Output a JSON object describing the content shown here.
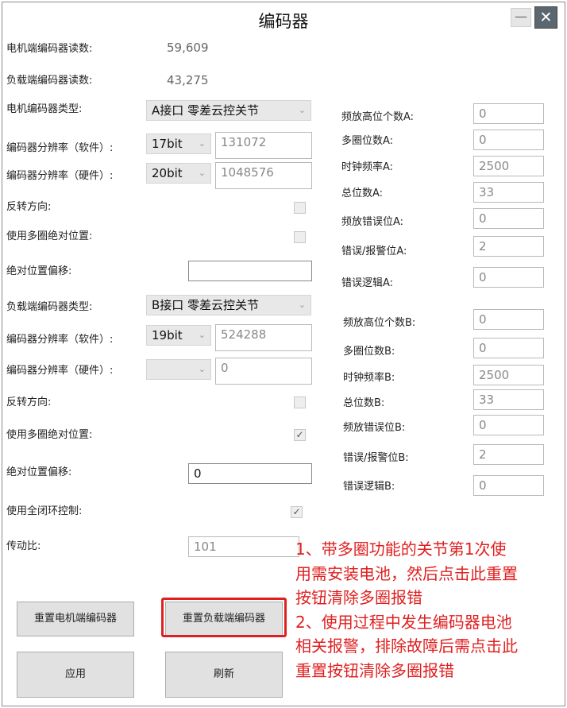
{
  "window": {
    "title": "编码器",
    "minimize": "—",
    "close": "✕"
  },
  "motor": {
    "count_label": "电机端编码器读数:",
    "count_value": "59,609",
    "type_label": "电机编码器类型:",
    "type_value": "A接口 零差云控关节",
    "res_sw_label": "编码器分辨率（软件）:",
    "res_sw_bits": "17bit",
    "res_sw_value": "131072",
    "res_hw_label": "编码器分辨率（硬件）:",
    "res_hw_bits": "20bit",
    "res_hw_value": "1048576",
    "reverse_label": "反转方向:",
    "reverse_checked": false,
    "multiturn_label": "使用多圈绝对位置:",
    "multiturn_checked": false,
    "offset_label": "绝对位置偏移:",
    "offset_value": ""
  },
  "load": {
    "count_label": "负载端编码器读数:",
    "count_value": "43,275",
    "type_label": "负载端编码器类型:",
    "type_value": "B接口 零差云控关节",
    "res_sw_label": "编码器分辨率（软件）:",
    "res_sw_bits": "19bit",
    "res_sw_value": "524288",
    "res_hw_label": "编码器分辨率（硬件）:",
    "res_hw_bits": "",
    "res_hw_value": "0",
    "reverse_label": "反转方向:",
    "reverse_checked": false,
    "multiturn_label": "使用多圈绝对位置:",
    "multiturn_checked": true,
    "offset_label": "绝对位置偏移:",
    "offset_value": "0",
    "fullclosed_label": "使用全闭环控制:",
    "fullclosed_checked": true,
    "ratio_label": "传动比:",
    "ratio_value": "101"
  },
  "params_a": [
    {
      "label": "频放高位个数A:",
      "value": "0"
    },
    {
      "label": "多圈位数A:",
      "value": "0"
    },
    {
      "label": "时钟频率A:",
      "value": "2500"
    },
    {
      "label": "总位数A:",
      "value": "33"
    },
    {
      "label": "频放错误位A:",
      "value": "0"
    },
    {
      "label": "错误/报警位A:",
      "value": "2"
    },
    {
      "label": "错误逻辑A:",
      "value": "0"
    }
  ],
  "params_b": [
    {
      "label": "频放高位个数B:",
      "value": "0"
    },
    {
      "label": "多圈位数B:",
      "value": "0"
    },
    {
      "label": "时钟频率B:",
      "value": "2500"
    },
    {
      "label": "总位数B:",
      "value": "33"
    },
    {
      "label": "频放错误位B:",
      "value": "0"
    },
    {
      "label": "错误/报警位B:",
      "value": "2"
    },
    {
      "label": "错误逻辑B:",
      "value": "0"
    }
  ],
  "buttons": {
    "reset_motor": "重置电机端编码器",
    "reset_load": "重置负载端编码器",
    "apply": "应用",
    "refresh": "刷新"
  },
  "annotation": {
    "color": "#e02020",
    "lines": [
      "1、带多圈功能的关节第1次使",
      "用需安装电池，然后点击此重置",
      "按钮清除多圈报错",
      "2、使用过程中发生编码器电池",
      "相关报警，排除故障后需点击此",
      "重置按钮清除多圈报错"
    ]
  },
  "icons": {
    "dropdown": "chevron-down-icon",
    "check": "checkmark-icon"
  }
}
